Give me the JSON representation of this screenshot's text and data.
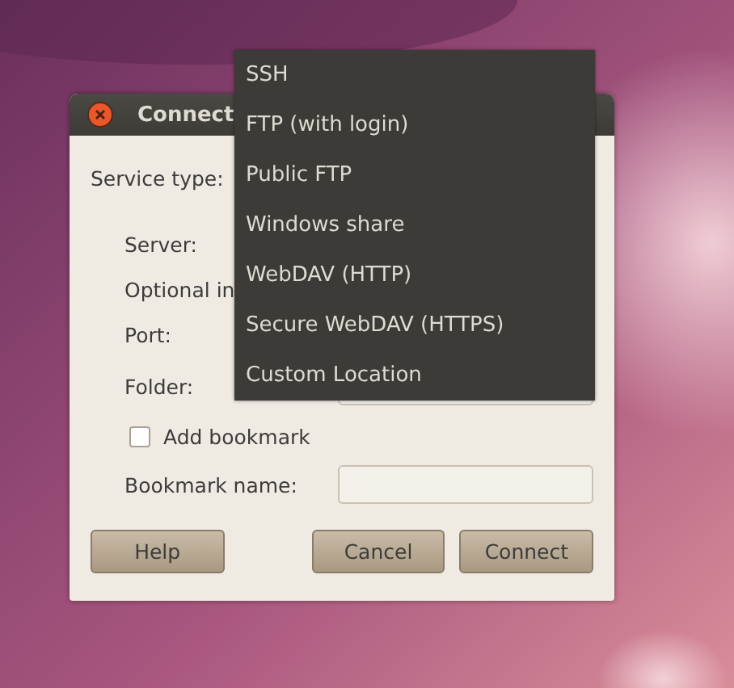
{
  "window": {
    "title": "Connect"
  },
  "form": {
    "service_label": "Service type:",
    "server_label": "Server:",
    "optional_label": "Optional in",
    "port_label": "Port:",
    "folder_label": "Folder:",
    "bookmark": {
      "label": "Add bookmark",
      "checked": false
    },
    "bookmark_name_label": "Bookmark name:"
  },
  "buttons": [
    "Help",
    "Cancel",
    "Connect"
  ],
  "menu": [
    {
      "label": "SSH",
      "selected": false
    },
    {
      "label": "FTP (with login)",
      "selected": false
    },
    {
      "label": "Public FTP",
      "selected": false
    },
    {
      "label": "Windows share",
      "selected": false
    },
    {
      "label": "WebDAV (HTTP)",
      "selected": false
    },
    {
      "label": "Secure WebDAV (HTTPS)",
      "selected": false
    },
    {
      "label": "Custom Location",
      "selected": false
    }
  ]
}
